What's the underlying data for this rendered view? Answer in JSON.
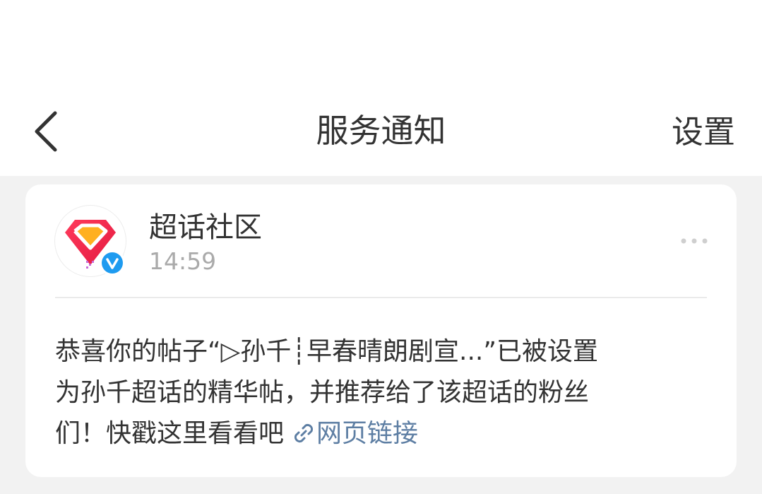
{
  "header": {
    "title": "服务通知",
    "settings_label": "设置"
  },
  "card": {
    "sender_name": "超话社区",
    "timestamp": "14:59",
    "message_lines": [
      "恭喜你的帖子“▷孙千┊早春晴朗剧宣...”已被设置",
      "为孙千超话的精华帖，并推荐给了该超话的粉丝",
      "们！快戳这里看看吧"
    ],
    "link_label": "网页链接"
  },
  "icons": {
    "back": "back-arrow-icon",
    "more": "more-dots-icon",
    "link": "link-icon",
    "verified": "verified-v-icon",
    "avatar": "diamond-logo-icon"
  },
  "colors": {
    "background": "#f2f2f2",
    "link": "#5d7ea3",
    "timestamp": "#aaaaaa",
    "verified_badge": "#1e9bf0"
  }
}
